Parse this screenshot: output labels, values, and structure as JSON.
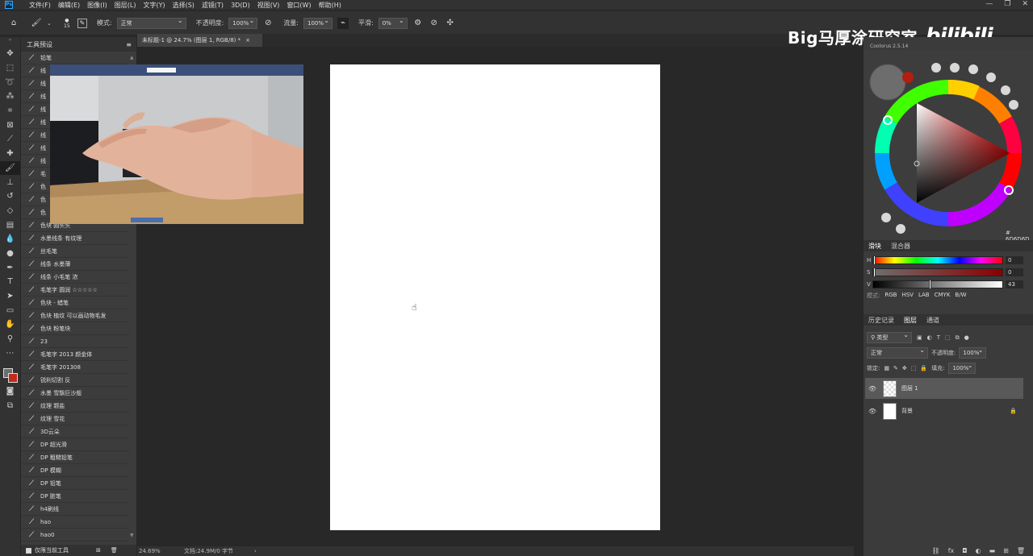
{
  "menu": {
    "logo": "Ps",
    "items": [
      "文件(F)",
      "编辑(E)",
      "图像(I)",
      "图层(L)",
      "文字(Y)",
      "选择(S)",
      "滤镜(T)",
      "3D(D)",
      "视图(V)",
      "窗口(W)",
      "帮助(H)"
    ],
    "window_controls": [
      "—",
      "❐",
      "✕"
    ]
  },
  "options": {
    "brush_size": "15",
    "mode_label": "模式:",
    "mode_value": "正常",
    "opacity_label": "不透明度:",
    "opacity_value": "100%",
    "flow_label": "流量:",
    "flow_value": "100%",
    "smoothing_label": "平滑:",
    "smoothing_value": "0%"
  },
  "tools": [
    "move-tool",
    "marquee-tool",
    "lasso-tool",
    "magic-wand-tool",
    "crop-tool",
    "frame-tool",
    "eyedropper-tool",
    "healing-tool",
    "brush-tool",
    "stamp-tool",
    "history-brush-tool",
    "eraser-tool",
    "gradient-tool",
    "blur-tool",
    "dodge-tool",
    "pen-tool",
    "type-tool",
    "path-select-tool",
    "shape-tool",
    "hand-tool",
    "zoom-tool",
    "more-tool"
  ],
  "preset_panel": {
    "title": "工具预设",
    "items": [
      "铅笔",
      "线",
      "线",
      "线",
      "线",
      "线",
      "线",
      "线",
      "线",
      "毛",
      "色",
      "色",
      "色",
      "色块 圆头头",
      "水墨线条 有纹理",
      "丝毛笔",
      "线条 水墨薄",
      "线条 小毛笔 浓",
      "毛笔字 圆润 ☆☆☆☆☆",
      "色块 - 蜡笔",
      "色块 植纹 可以画动物毛发",
      "色块 粉笔块",
      "23",
      "毛笔字 2013 颜金体",
      "毛笔字 201308",
      "锐利切割 反",
      "水墨 雪飘巨沙般",
      "纹理 颗盐",
      "纹理 雪花",
      "3D云朵",
      "DP 超光滑",
      "DP 粗糙铅笔",
      "DP 模糊",
      "DP 铅笔",
      "DP 脏笔",
      "h4刷线",
      "hao",
      "hao0"
    ],
    "footer_label": "仅限当前工具"
  },
  "document": {
    "tab_title": "未标题-1 @ 24.7% (图层 1, RGB/8) *",
    "zoom": "24.69%",
    "doc_info": "文档:24.9M/0 字节"
  },
  "watermark": {
    "text": "Big马厚涂研究室",
    "logo": "bilibili"
  },
  "color_panel": {
    "plugin_label": "Coolorus 2.5.14",
    "hex": "# 6D6D6D",
    "tabs": [
      "滑块",
      "混合器"
    ],
    "sliders": [
      {
        "label": "H",
        "value": "0",
        "pos": 0.0
      },
      {
        "label": "S",
        "value": "0",
        "pos": 0.0
      },
      {
        "label": "V",
        "value": "43",
        "pos": 0.43
      }
    ],
    "modes_label": "模式:",
    "modes": [
      "RGB",
      "HSV",
      "LAB",
      "CMYK",
      "B/W"
    ]
  },
  "layers_panel": {
    "tabs": [
      "历史记录",
      "图层",
      "通道"
    ],
    "filter_label": "类型",
    "blend_mode": "正常",
    "opacity_label": "不透明度:",
    "opacity_value": "100%",
    "lock_label": "锁定:",
    "fill_label": "填充:",
    "fill_value": "100%",
    "layers": [
      {
        "name": "图层 1",
        "selected": true
      },
      {
        "name": "背景",
        "selected": false
      }
    ]
  }
}
